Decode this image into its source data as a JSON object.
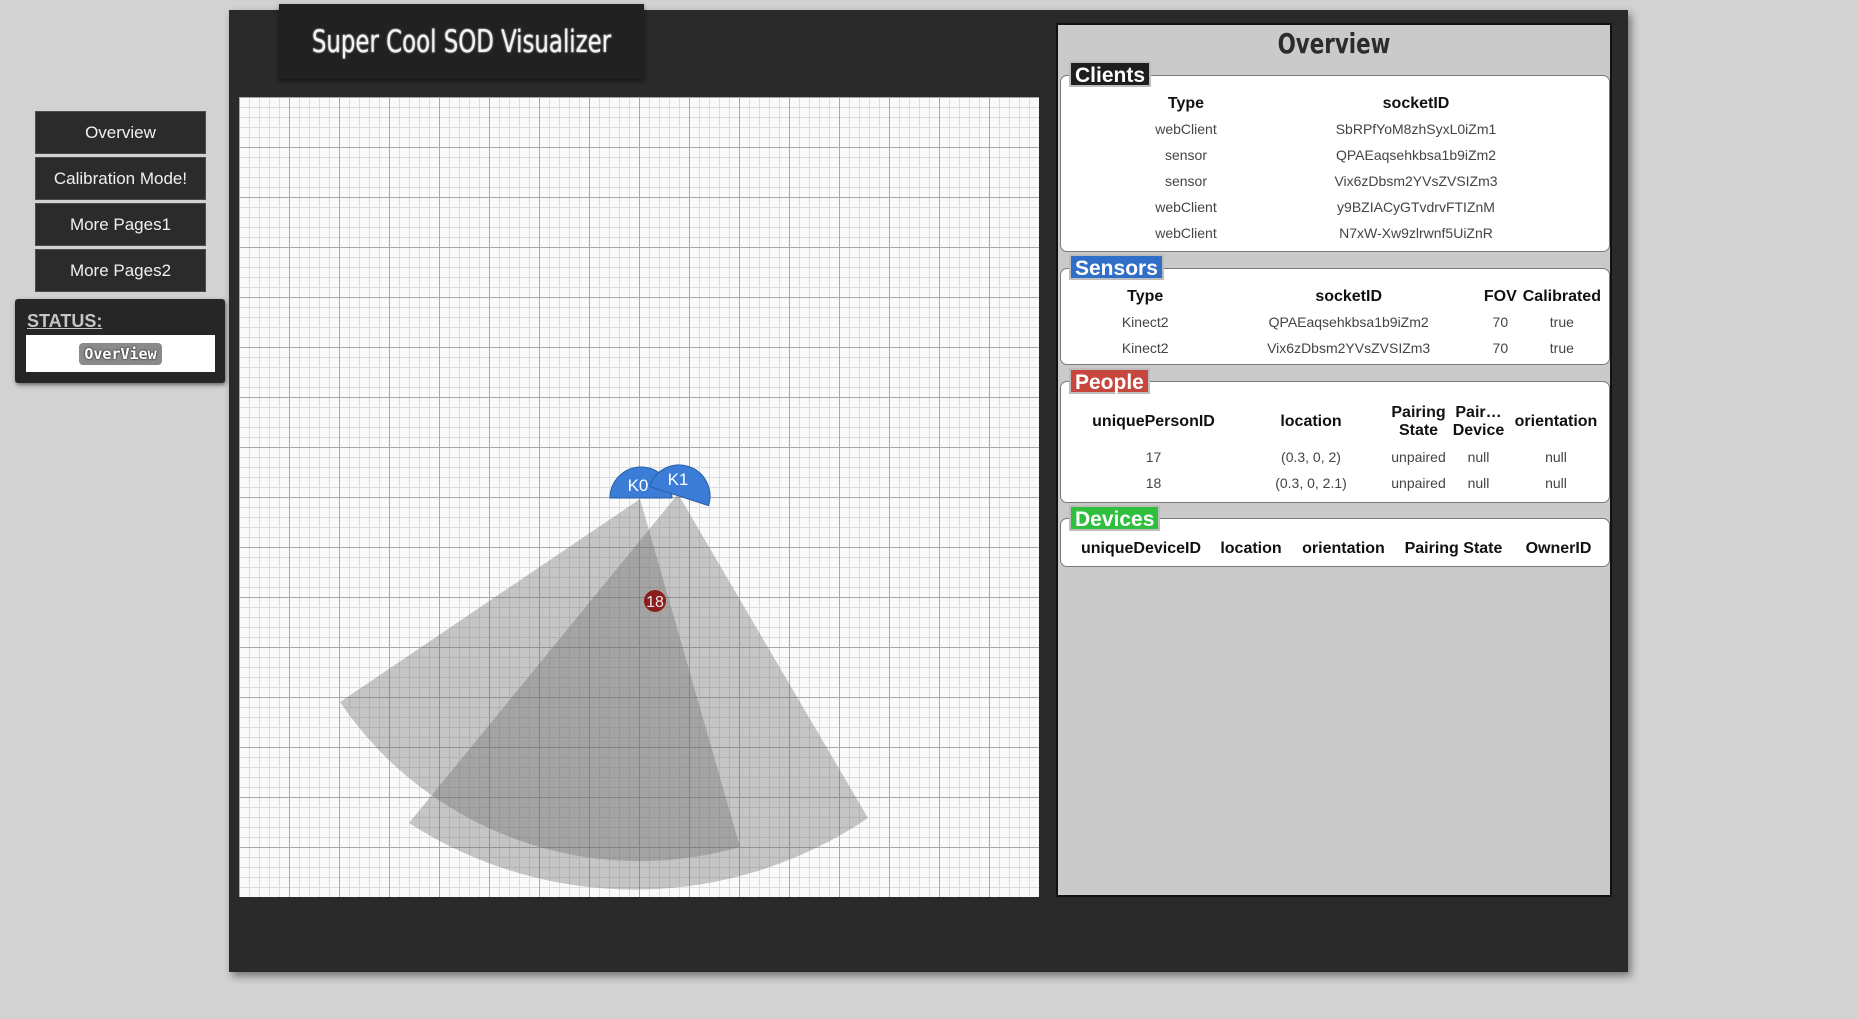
{
  "app": {
    "title": "Super Cool SOD Visualizer"
  },
  "nav": [
    {
      "label": "Overview"
    },
    {
      "label": "Calibration Mode!"
    },
    {
      "label": "More Pages1"
    },
    {
      "label": "More Pages2"
    }
  ],
  "status": {
    "label": "STATUS:",
    "value": "OverView"
  },
  "overview": {
    "title": "Overview"
  },
  "clients": {
    "tag": "Clients",
    "tag_color": "#1e1e1e",
    "headers": [
      "Type",
      "socketID"
    ],
    "rows": [
      [
        "webClient",
        "SbRPfYoM8zhSyxL0iZm1"
      ],
      [
        "sensor",
        "QPAEaqsehkbsa1b9iZm2"
      ],
      [
        "sensor",
        "Vix6zDbsm2YVsZVSIZm3"
      ],
      [
        "webClient",
        "y9BZIACyGTvdrvFTIZnM"
      ],
      [
        "webClient",
        "N7xW-Xw9zlrwnf5UiZnR"
      ]
    ]
  },
  "sensors": {
    "tag": "Sensors",
    "tag_color": "#2f6fc7",
    "headers": [
      "Type",
      "socketID",
      "FOV",
      "Calibrated"
    ],
    "rows": [
      [
        "Kinect2",
        "QPAEaqsehkbsa1b9iZm2",
        "70",
        "true"
      ],
      [
        "Kinect2",
        "Vix6zDbsm2YVsZVSIZm3",
        "70",
        "true"
      ]
    ]
  },
  "people": {
    "tag": "People",
    "tag_color": "#c7473e",
    "headers": [
      "uniquePersonID",
      "location",
      "Pairing State",
      "Pair… Device",
      "orientation"
    ],
    "rows": [
      [
        "17",
        "(0.3, 0, 2)",
        "unpaired",
        "null",
        "null"
      ],
      [
        "18",
        "(0.3, 0, 2.1)",
        "unpaired",
        "null",
        "null"
      ]
    ]
  },
  "devices": {
    "tag": "Devices",
    "tag_color": "#2fbf3d",
    "headers": [
      "uniqueDeviceID",
      "location",
      "orientation",
      "Pairing State",
      "OwnerID"
    ],
    "rows": []
  },
  "canvas": {
    "sensor_color": "#3b7cd6",
    "person_color": "#8c1d1d",
    "sensors": [
      {
        "label": "K0",
        "heading_deg": 0,
        "fov_deg": 70
      },
      {
        "label": "K1",
        "heading_deg": -15,
        "fov_deg": 70
      }
    ],
    "people": [
      {
        "label": "18"
      }
    ]
  }
}
